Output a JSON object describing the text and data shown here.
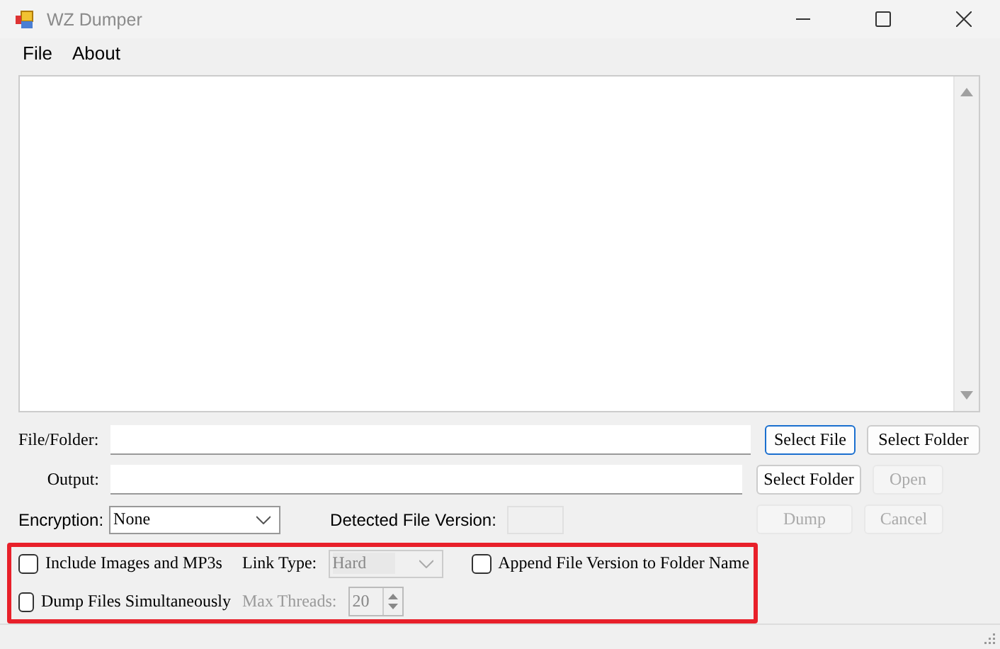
{
  "window": {
    "title": "WZ Dumper"
  },
  "menu": [
    {
      "label": "File"
    },
    {
      "label": "About"
    }
  ],
  "file_folder": {
    "label": "File/Folder:",
    "buttons": [
      {
        "label": "Select File",
        "focused": true,
        "disabled": false
      },
      {
        "label": "Select Folder",
        "focused": false,
        "disabled": false
      }
    ]
  },
  "output": {
    "label": "Output:",
    "buttons": [
      {
        "label": "Select Folder",
        "focused": false,
        "disabled": false
      },
      {
        "label": "Open",
        "focused": false,
        "disabled": true
      }
    ]
  },
  "encryption": {
    "label": "Encryption:",
    "value": "None"
  },
  "detected_version": {
    "label": "Detected File Version:"
  },
  "actions": [
    {
      "label": "Dump",
      "focused": false,
      "disabled": true
    },
    {
      "label": "Cancel",
      "focused": false,
      "disabled": true
    }
  ],
  "options": {
    "highlighted": true,
    "include_images": {
      "label": "Include Images and MP3s",
      "checked": false
    },
    "link_type": {
      "label": "Link Type:",
      "value": "Hard",
      "disabled": true
    },
    "append_version": {
      "label": "Append File Version to Folder Name",
      "checked": false
    },
    "dump_simultaneously": {
      "label": "Dump Files Simultaneously",
      "checked": false
    },
    "max_threads": {
      "label": "Max Threads:",
      "value": "20",
      "disabled": true
    }
  }
}
